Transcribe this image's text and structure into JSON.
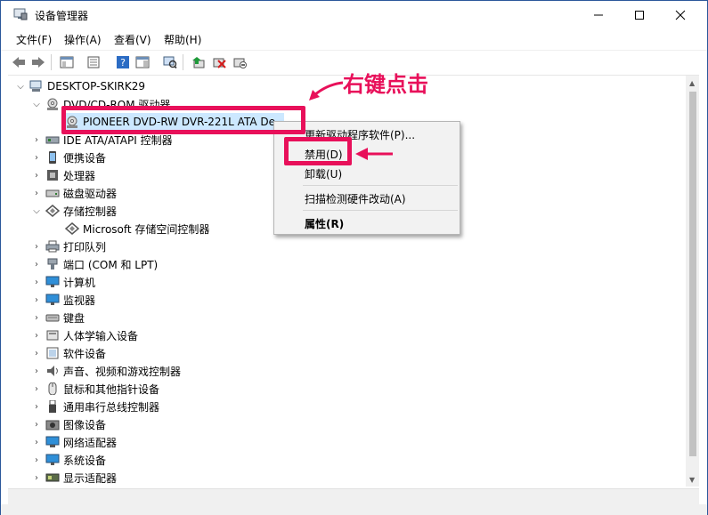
{
  "window": {
    "title": "设备管理器",
    "controls": [
      "minimize",
      "maximize",
      "close"
    ]
  },
  "menu": {
    "items": [
      "文件(F)",
      "操作(A)",
      "查看(V)",
      "帮助(H)"
    ]
  },
  "toolbar": {
    "icons": [
      "back-icon",
      "forward-icon",
      "show-hide-tree-icon",
      "properties-icon",
      "help-icon",
      "action-pane-icon",
      "scan-hardware-icon",
      "update-driver-icon",
      "uninstall-device-icon",
      "disable-device-icon"
    ]
  },
  "tree": {
    "root": "DESKTOP-SKIRK29",
    "dvd_category": "DVD/CD-ROM 驱动器",
    "dvd_device": "PIONEER DVD-RW  DVR-221L ATA De",
    "ide": "IDE ATA/ATAPI 控制器",
    "portable": "便携设备",
    "processor": "处理器",
    "disk": "磁盘驱动器",
    "storage": "存储控制器",
    "storage_child": "Microsoft 存储空间控制器",
    "print_queue": "打印队列",
    "ports": "端口 (COM 和 LPT)",
    "computer": "计算机",
    "monitor": "监视器",
    "keyboard": "键盘",
    "hid": "人体学输入设备",
    "software": "软件设备",
    "sound": "声音、视频和游戏控制器",
    "mouse": "鼠标和其他指针设备",
    "usb": "通用串行总线控制器",
    "imaging": "图像设备",
    "network": "网络适配器",
    "system": "系统设备",
    "display": "显示适配器"
  },
  "context_menu": {
    "update_driver": "更新驱动程序软件(P)...",
    "disable": "禁用(D)",
    "uninstall": "卸载(U)",
    "scan": "扫描检测硬件改动(A)",
    "properties": "属性(R)"
  },
  "annotation": {
    "text": "右键点击",
    "color": "#e8105a"
  }
}
